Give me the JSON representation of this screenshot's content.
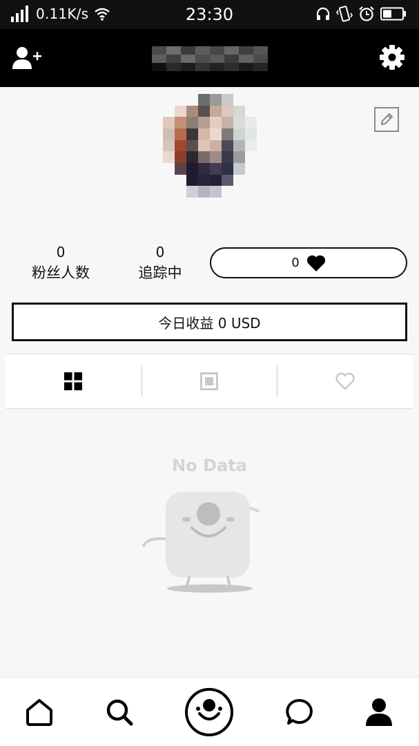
{
  "status_bar": {
    "net_speed": "0.11K/s",
    "time": "23:30",
    "icons": [
      "signal-icon",
      "wifi-icon",
      "headphones-icon",
      "vibrate-icon",
      "alarm-icon",
      "battery-icon"
    ]
  },
  "top_bar": {
    "left_icon": "add-user-icon",
    "right_icon": "gear-icon"
  },
  "profile": {
    "fans_count": "0",
    "fans_label": "粉丝人数",
    "following_count": "0",
    "following_label": "追踪中",
    "likes_count": "0",
    "earnings_label": "今日收益 0 USD"
  },
  "tabs": [
    {
      "icon": "grid-icon",
      "active": true
    },
    {
      "icon": "single-post-icon",
      "active": false
    },
    {
      "icon": "heart-outline-icon",
      "active": false
    }
  ],
  "empty_state": {
    "text": "No Data"
  },
  "bottom_nav": [
    {
      "icon": "home-icon"
    },
    {
      "icon": "search-icon"
    },
    {
      "icon": "camera-face-icon"
    },
    {
      "icon": "chat-bubble-icon"
    },
    {
      "icon": "profile-icon"
    }
  ],
  "colors": {
    "bar_bg": "#000000",
    "page_bg": "#f7f7f7",
    "muted": "#d4d4d4"
  }
}
